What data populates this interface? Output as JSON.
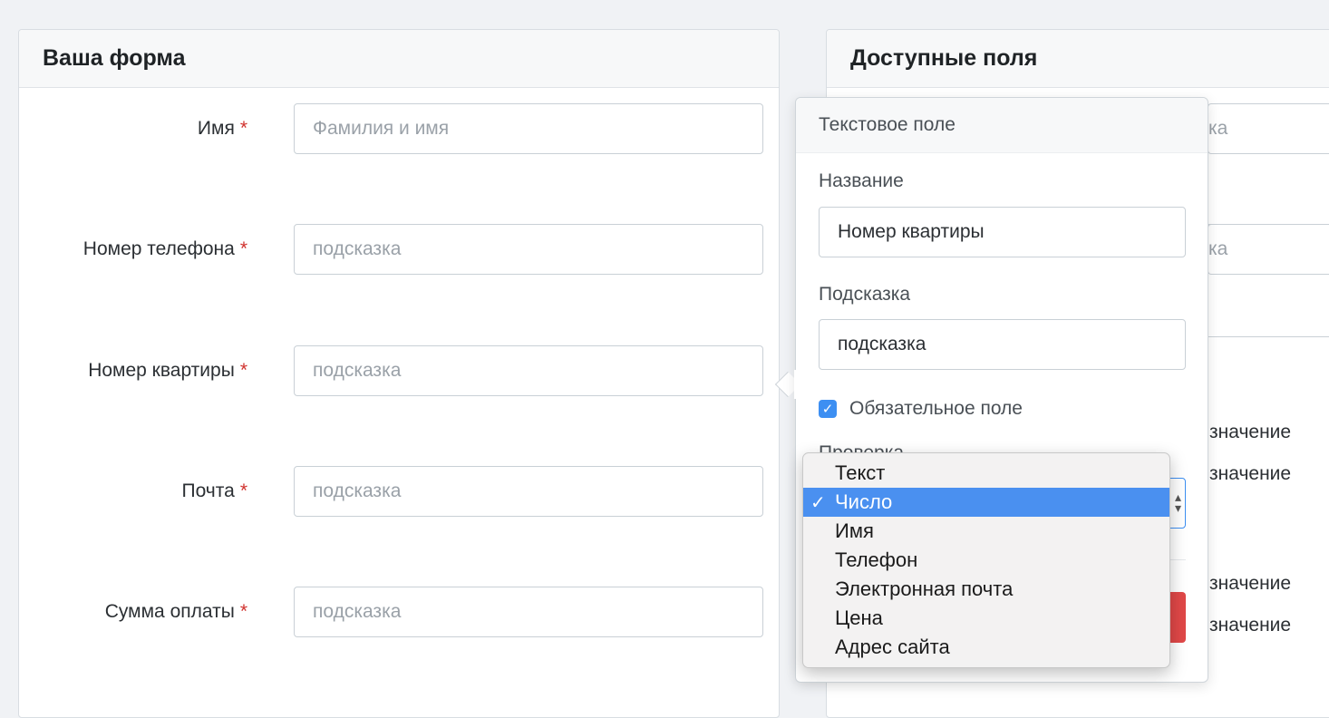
{
  "form": {
    "title": "Ваша форма",
    "required_mark": "*",
    "fields": [
      {
        "label": "Имя",
        "placeholder": "Фамилия и имя"
      },
      {
        "label": "Номер телефона",
        "placeholder": "подсказка"
      },
      {
        "label": "Номер квартиры",
        "placeholder": "подсказка"
      },
      {
        "label": "Почта",
        "placeholder": "подсказка"
      },
      {
        "label": "Сумма оплаты",
        "placeholder": "подсказка"
      }
    ]
  },
  "available": {
    "title": "Доступные поля",
    "fragments": {
      "hint1": "ка",
      "hint2": "ка",
      "value": "значение"
    }
  },
  "popover": {
    "title": "Текстовое поле",
    "name_label": "Название",
    "name_value": "Номер квартиры",
    "hint_label": "Подсказка",
    "hint_value": "подсказка",
    "required_label": "Обязательное поле",
    "required_checked": true,
    "validation_label": "Проверка"
  },
  "dropdown": {
    "selected": "Число",
    "options": [
      "Текст",
      "Число",
      "Имя",
      "Телефон",
      "Электронная почта",
      "Цена",
      "Адрес сайта"
    ]
  },
  "colors": {
    "accent": "#3d8ff2",
    "danger": "#e04848",
    "required": "#d0312d"
  }
}
